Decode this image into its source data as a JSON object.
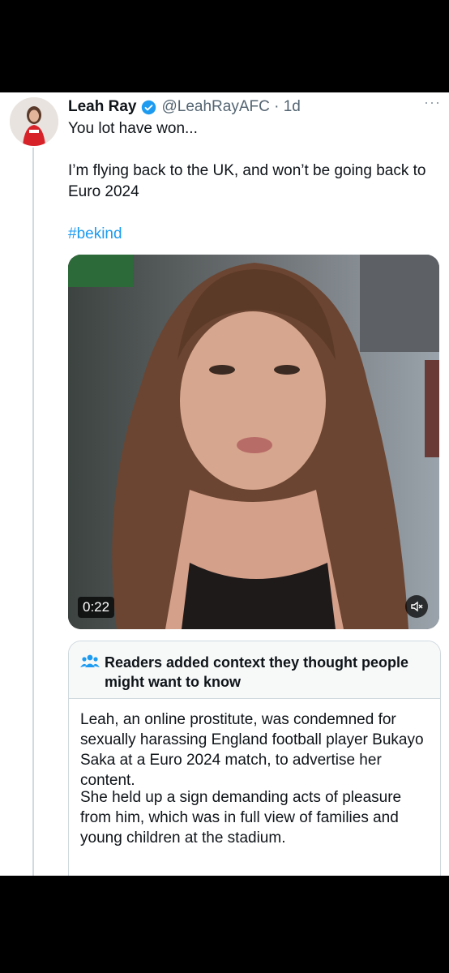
{
  "tweet": {
    "name": "Leah Ray",
    "handle": "@LeahRayAFC · 1d",
    "more": "···",
    "line1": "You lot have won...",
    "line2": "I’m flying back to the UK, and won’t be going back to Euro 2024",
    "hashtag": "#bekind"
  },
  "video": {
    "duration": "0:22",
    "icons": {
      "mute": "speaker-muted-icon"
    }
  },
  "note": {
    "title": "Readers added context they thought people might want to know",
    "paragraph1": "Leah, an online prostitute, was condemned for sexually harassing England football player Bukayo Saka at a Euro 2024 match, to advertise her  content.",
    "paragraph2": "She held up a sign demanding acts of pleasure from him, which was in full view of families and young children at the stadium."
  },
  "colors": {
    "link": "#1d9bf0",
    "verified": "#1d9bf0",
    "muted_text": "#536471"
  }
}
